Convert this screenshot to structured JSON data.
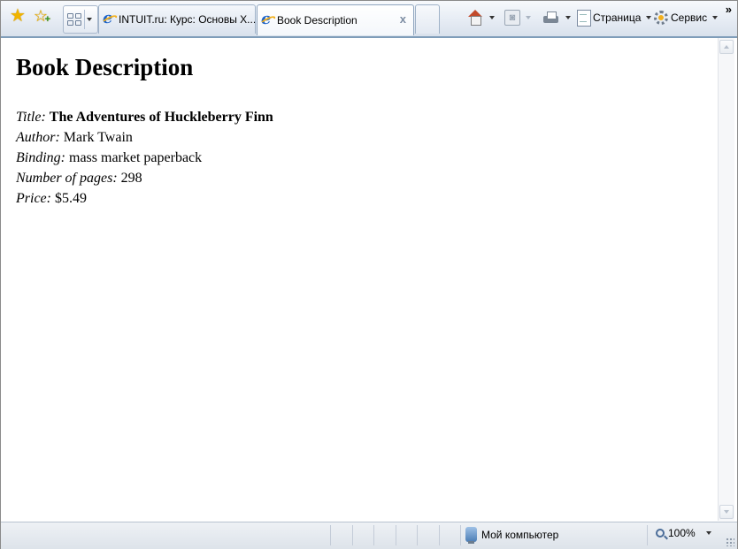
{
  "toolbar": {
    "tabs": [
      {
        "label": "INTUIT.ru: Курс: Основы X..."
      },
      {
        "label": "Book Description",
        "close": "x"
      }
    ],
    "commands": {
      "page_label": "Страница",
      "tools_label": "Сервис",
      "more": "»"
    }
  },
  "page": {
    "heading": "Book Description",
    "fields": [
      {
        "label": "Title:",
        "value": "The Adventures of Huckleberry Finn"
      },
      {
        "label": "Author:",
        "value": "Mark Twain"
      },
      {
        "label": "Binding:",
        "value": "mass market paperback"
      },
      {
        "label": "Number of pages:",
        "value": "298"
      },
      {
        "label": "Price:",
        "value": "$5.49"
      }
    ]
  },
  "statusbar": {
    "zone": "Мой компьютер",
    "zoom": "100%"
  },
  "icons": {
    "favorites": "favorites-star-icon",
    "add_favorites": "add-favorites-icon",
    "quick_tabs": "quick-tabs-icon",
    "home": "home-icon",
    "feeds": "rss-icon",
    "print": "print-icon",
    "page": "page-icon",
    "tools": "gear-icon",
    "zone": "computer-icon",
    "zoom": "zoom-icon"
  }
}
